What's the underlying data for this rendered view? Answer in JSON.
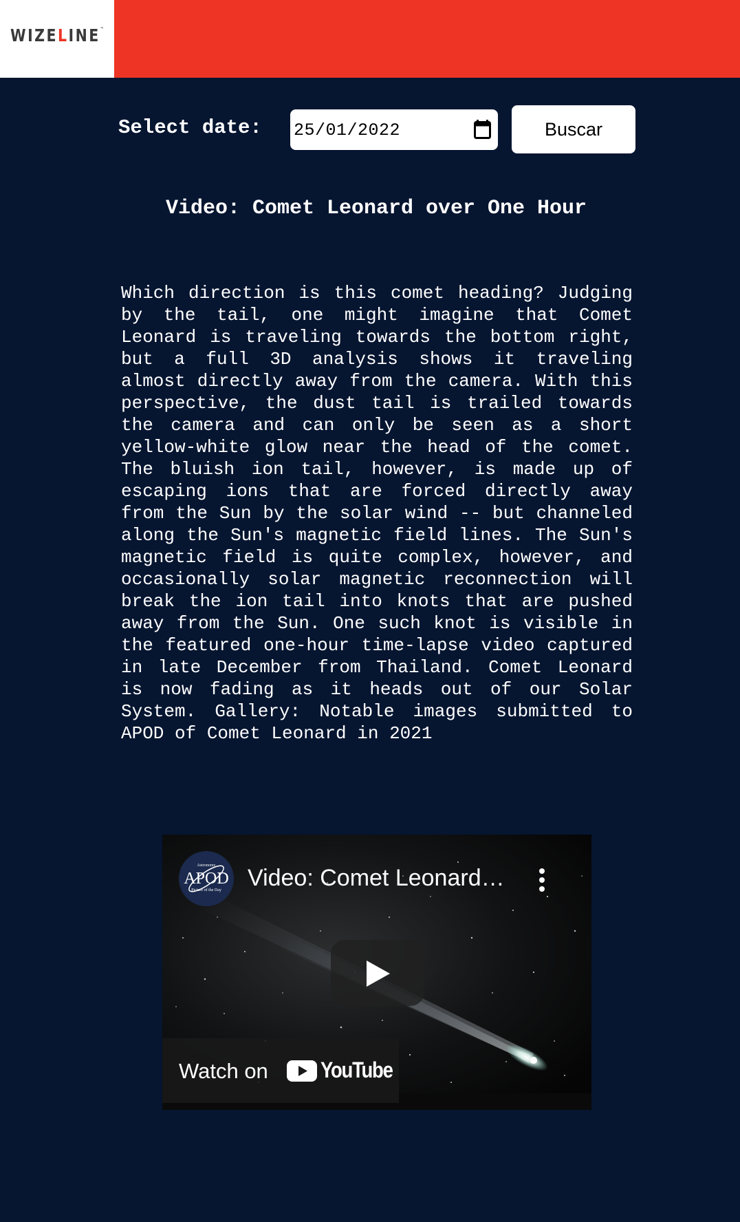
{
  "header": {
    "logo": {
      "prefix": "WIZE",
      "accent": "L",
      "suffix": "INE"
    },
    "brand_color": "#ee3424"
  },
  "controls": {
    "date_label": "Select date:",
    "date_value": "25/01/2022",
    "search_label": "Buscar"
  },
  "apod": {
    "title": "Video: Comet Leonard over One Hour",
    "explanation": "Which direction is this comet heading? Judging by the tail, one might imagine that Comet Leonard is traveling towards the bottom right, but a full 3D analysis shows it traveling almost directly away from the camera. With this perspective, the dust tail is trailed towards the camera and can only be seen as a short yellow-white glow near the head of the comet. The bluish ion tail, however, is made up of escaping ions that are forced directly away from the Sun by the solar wind -- but channeled along the Sun's magnetic field lines. The Sun's magnetic field is quite complex, however, and occasionally solar magnetic reconnection will break the ion tail into knots that are pushed away from the Sun. One such knot is visible in the featured one-hour time-lapse video captured in late December from Thailand. Comet Leonard is now fading as it heads out of our Solar System. Gallery: Notable images submitted to APOD of Comet Leonard in 2021"
  },
  "video": {
    "title": "Video: Comet Leonard…",
    "watch_on": "Watch on",
    "youtube_wordmark": "YouTube",
    "avatar_text": {
      "top": "Astronomy",
      "main": "APOD",
      "bottom": "Picture of the Day"
    },
    "icons": [
      "calendar-icon",
      "more-vert-icon",
      "play-icon",
      "youtube-icon"
    ]
  },
  "colors": {
    "background": "#061530",
    "text": "#ffffff",
    "youtube_red": "#ff0000"
  }
}
